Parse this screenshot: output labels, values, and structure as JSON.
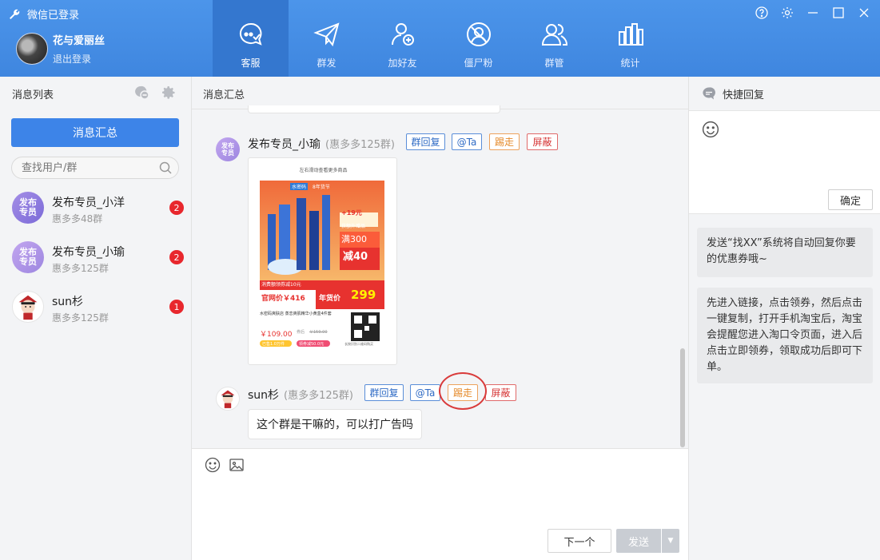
{
  "window": {
    "title": "微信已登录"
  },
  "profile": {
    "name": "花与爱丽丝",
    "logout": "退出登录"
  },
  "nav": [
    {
      "label": "客服",
      "icon": "chat-bubble-icon",
      "active": true
    },
    {
      "label": "群发",
      "icon": "paper-plane-icon",
      "active": false
    },
    {
      "label": "加好友",
      "icon": "add-friend-icon",
      "active": false
    },
    {
      "label": "僵尸粉",
      "icon": "zombie-fan-icon",
      "active": false
    },
    {
      "label": "群管",
      "icon": "group-manage-icon",
      "active": false
    },
    {
      "label": "统计",
      "icon": "bar-stats-icon",
      "active": false
    }
  ],
  "left": {
    "title": "消息列表",
    "summary_button": "消息汇总",
    "search_placeholder": "查找用户/群",
    "conversations": [
      {
        "name": "发布专员_小洋",
        "group": "惠多多48群",
        "unread": "2",
        "avatar_text": "发布专员"
      },
      {
        "name": "发布专员_小瑜",
        "group": "惠多多125群",
        "unread": "2",
        "avatar_text": "发布专员"
      },
      {
        "name": "sun杉",
        "group": "惠多多125群",
        "unread": "1",
        "avatar_text": ""
      }
    ]
  },
  "center": {
    "title": "消息汇总",
    "messages": [
      {
        "sender": "发布专员_小瑜",
        "group": "(惠多多125群)",
        "avatar_text": "发布专员",
        "actions": [
          "群回复",
          "@Ta",
          "踢走",
          "屏蔽"
        ],
        "image": {
          "top_hint": "左右滑动查看更多商品",
          "brand": "水密码",
          "promo": "8年货节",
          "coupon_amount": "+19元",
          "full_reduce_top": "满300",
          "full_reduce_bottom": "减40",
          "gift_tag": "获额外赠品",
          "coupon_bar": "消费额领券减10元",
          "official_price": "官网价￥416",
          "year_price_label": "年货价",
          "year_price": "299",
          "title": "水密码爽肤店 蒸恋爽肌精华小黄盒4件套",
          "price": "￥109.00",
          "price_tag": "券后",
          "orig_price": "￥159.00",
          "sold": "已售1.0万件",
          "coupon_tag": "领券减50.0元",
          "qr_caption": "长按识别二维码购买"
        }
      },
      {
        "sender": "sun杉",
        "group": "(惠多多125群)",
        "actions": [
          "群回复",
          "@Ta",
          "踢走",
          "屏蔽"
        ],
        "text": "这个群是干嘛的，可以打广告吗"
      }
    ],
    "compose": {
      "next": "下一个",
      "send": "发送"
    }
  },
  "right": {
    "title": "快捷回复",
    "confirm": "确定",
    "quick_replies": [
      "发送“找XX”系统将自动回复你要的优惠券哦~",
      "先进入链接，点击领券，然后点击一键复制，打开手机淘宝后，淘宝会提醒您进入淘口令页面，进入后点击立即领券，领取成功后即可下单。"
    ]
  },
  "colors": {
    "header": "#4a90e2",
    "nav_active": "#3477cf",
    "primary": "#3d84e8",
    "badge": "#e8272d",
    "tag_blue": "#2f6bc5",
    "tag_orange": "#e58a2a",
    "tag_red": "#d53333"
  }
}
